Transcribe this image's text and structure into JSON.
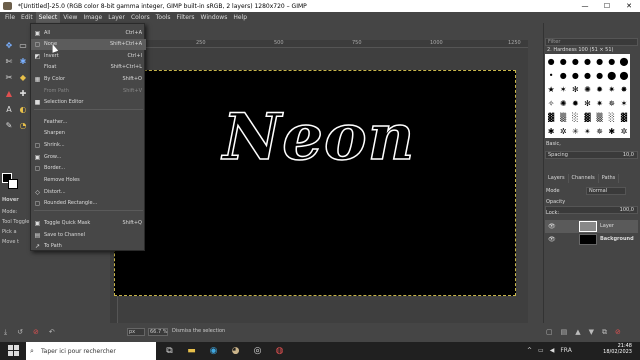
{
  "window": {
    "title": "*[Untitled]-25.0 (RGB color 8-bit gamma integer, GIMP built-in sRGB, 2 layers) 1280x720 – GIMP",
    "min": "—",
    "max": "☐",
    "close": "✕"
  },
  "menubar": [
    "File",
    "Edit",
    "Select",
    "View",
    "Image",
    "Layer",
    "Colors",
    "Tools",
    "Filters",
    "Windows",
    "Help"
  ],
  "select_menu": [
    {
      "icon": "select-all-icon",
      "glyph": "▣",
      "label": "All",
      "shortcut": "Ctrl+A",
      "disabled": false,
      "highlighted": false
    },
    {
      "icon": "select-none-icon",
      "glyph": "▢",
      "label": "None",
      "shortcut": "Shift+Ctrl+A",
      "disabled": false,
      "highlighted": true
    },
    {
      "icon": "invert-icon",
      "glyph": "◩",
      "label": "Invert",
      "shortcut": "Ctrl+I",
      "disabled": false,
      "highlighted": false
    },
    {
      "icon": "float-icon",
      "glyph": "",
      "label": "Float",
      "shortcut": "Shift+Ctrl+L",
      "disabled": false,
      "highlighted": false
    },
    {
      "icon": "by-color-icon",
      "glyph": "▦",
      "label": "By Color",
      "shortcut": "Shift+O",
      "disabled": false,
      "highlighted": false
    },
    {
      "icon": "from-path-icon",
      "glyph": "",
      "label": "From Path",
      "shortcut": "Shift+V",
      "disabled": true,
      "highlighted": false
    },
    {
      "icon": "selection-editor-icon",
      "glyph": "■",
      "label": "Selection Editor",
      "shortcut": "",
      "disabled": false,
      "highlighted": false
    },
    {
      "icon": "feather-icon",
      "glyph": "",
      "label": "Feather...",
      "shortcut": "",
      "disabled": false,
      "highlighted": false
    },
    {
      "icon": "sharpen-icon",
      "glyph": "",
      "label": "Sharpen",
      "shortcut": "",
      "disabled": false,
      "highlighted": false
    },
    {
      "icon": "shrink-icon",
      "glyph": "▢",
      "label": "Shrink...",
      "shortcut": "",
      "disabled": false,
      "highlighted": false
    },
    {
      "icon": "grow-icon",
      "glyph": "▣",
      "label": "Grow...",
      "shortcut": "",
      "disabled": false,
      "highlighted": false
    },
    {
      "icon": "border-icon",
      "glyph": "▢",
      "label": "Border...",
      "shortcut": "",
      "disabled": false,
      "highlighted": false
    },
    {
      "icon": "remove-holes-icon",
      "glyph": "",
      "label": "Remove Holes",
      "shortcut": "",
      "disabled": false,
      "highlighted": false
    },
    {
      "icon": "distort-icon",
      "glyph": "◇",
      "label": "Distort...",
      "shortcut": "",
      "disabled": false,
      "highlighted": false
    },
    {
      "icon": "rounded-rectangle-icon",
      "glyph": "▢",
      "label": "Rounded Rectangle...",
      "shortcut": "",
      "disabled": false,
      "highlighted": false
    },
    {
      "icon": "quick-mask-icon",
      "glyph": "▣",
      "label": "Toggle Quick Mask",
      "shortcut": "Shift+Q",
      "disabled": false,
      "highlighted": false
    },
    {
      "icon": "save-channel-icon",
      "glyph": "▤",
      "label": "Save to Channel",
      "shortcut": "",
      "disabled": false,
      "highlighted": false
    },
    {
      "icon": "to-path-icon",
      "glyph": "↗",
      "label": "To Path",
      "shortcut": "",
      "disabled": false,
      "highlighted": false
    }
  ],
  "ruler_ticks": [
    "250",
    "500",
    "750",
    "1000",
    "1250"
  ],
  "canvas_text": "Neon",
  "tool_options": {
    "title": "Hover",
    "mode": "Mode:",
    "toggle": "Tool Toggle",
    "pick": "Pick a",
    "move": "Move t"
  },
  "status": {
    "unit": "px",
    "zoom": "66.7 %",
    "message": "Dismiss the selection"
  },
  "dock": {
    "filter_placeholder": "Filter",
    "brush_name": "2. Hardness 100 (51 × 51)",
    "preset": "Basic,",
    "spacing_label": "Spacing",
    "spacing_value": "10,0",
    "tabs": [
      "Layers",
      "Channels",
      "Paths"
    ],
    "mode_label": "Mode",
    "mode_value": "Normal",
    "opacity_label": "Opacity",
    "opacity_value": "100,0",
    "lock_label": "Lock:",
    "layers": [
      {
        "name": "Layer"
      },
      {
        "name": "Background"
      }
    ]
  },
  "taskbar": {
    "search": "Taper ici pour rechercher",
    "lang": "FRA",
    "time": "21:48",
    "date": "18/02/2023"
  }
}
